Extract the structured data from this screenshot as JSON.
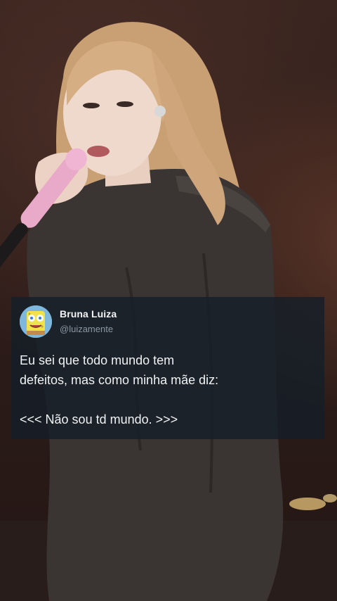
{
  "tweet": {
    "display_name": "Bruna Luiza",
    "handle": "@luizamente",
    "line1": "Eu sei que todo mundo tem",
    "line2": "defeitos, mas como minha mãe diz:",
    "line3": "<<< Não sou td mundo. >>>"
  },
  "background": {
    "icon": "concert-photo-singer-with-microphone"
  },
  "colors": {
    "card_bg": "#151e28",
    "name_text": "#f2f4f6",
    "handle_text": "#8a96a3",
    "body_text": "#f0f2f4"
  }
}
